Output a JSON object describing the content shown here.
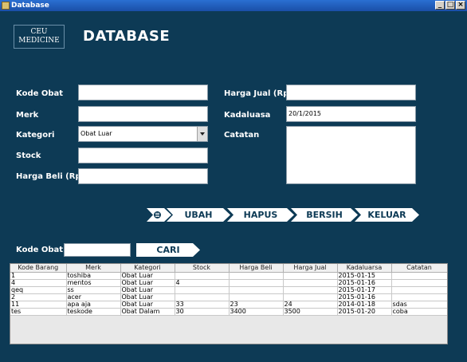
{
  "window": {
    "title": "Database",
    "min": "_",
    "max": "□",
    "close": "×"
  },
  "header": {
    "logo": [
      "CEU",
      "MEDICINE"
    ],
    "title": "DATABASE"
  },
  "form": {
    "kode_obat_label": "Kode Obat",
    "kode_obat_value": "",
    "merk_label": "Merk",
    "merk_value": "",
    "kategori_label": "Kategori",
    "kategori_value": "Obat Luar",
    "stock_label": "Stock",
    "stock_value": "",
    "harga_beli_label": "Harga Beli (Rp.)",
    "harga_beli_value": "",
    "harga_jual_label": "Harga Jual (Rp.)",
    "harga_jual_value": "",
    "kadaluasa_label": "Kadaluasa",
    "kadaluasa_value": "20/1/2015",
    "catatan_label": "Catatan",
    "catatan_value": ""
  },
  "actions": {
    "ubah": "UBAH",
    "hapus": "HAPUS",
    "bersih": "BERSIH",
    "keluar": "KELUAR"
  },
  "search": {
    "label": "Kode Obat",
    "value": "",
    "button": "CARI"
  },
  "table": {
    "columns": [
      "Kode Barang",
      "Merk",
      "Kategori",
      "Stock",
      "Harga Beli",
      "Harga Jual",
      "Kadaluarsa",
      "Catatan"
    ],
    "rows": [
      [
        "1",
        "toshiba",
        "Obat Luar",
        "",
        "",
        "",
        "2015-01-15",
        ""
      ],
      [
        "4",
        "mentos",
        "Obat Luar",
        "4",
        "",
        "",
        "2015-01-16",
        ""
      ],
      [
        "qeq",
        "ss",
        "Obat Luar",
        "",
        "",
        "",
        "2015-01-17",
        ""
      ],
      [
        "2",
        "acer",
        "Obat Luar",
        "",
        "",
        "",
        "2015-01-16",
        ""
      ],
      [
        "11",
        "apa aja",
        "Obat Luar",
        "33",
        "23",
        "24",
        "2014-01-18",
        "sdas"
      ],
      [
        "tes",
        "teskode",
        "Obat Dalam",
        "30",
        "3400",
        "3500",
        "2015-01-20",
        "coba"
      ]
    ]
  }
}
